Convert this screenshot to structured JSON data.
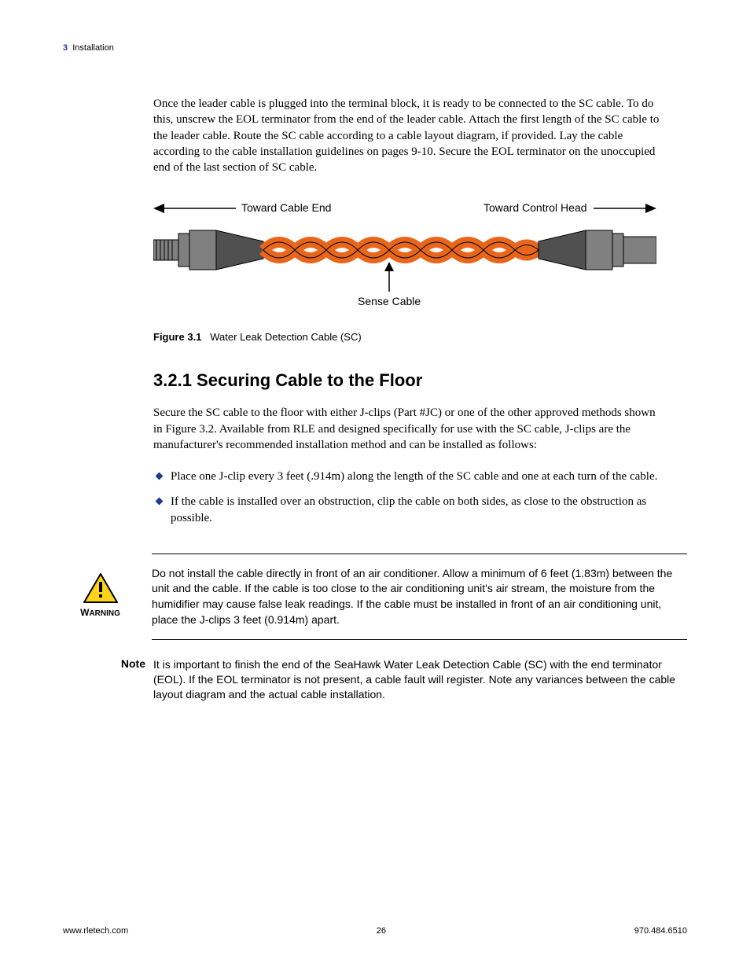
{
  "header": {
    "chapter_num": "3",
    "chapter_title": "Installation"
  },
  "intro_para": "Once the leader cable is plugged into the terminal block, it is ready to be connected to the SC cable. To do this, unscrew the EOL terminator from the end of the leader cable. Attach the first length of the SC cable to the leader cable. Route the SC cable according to a cable layout diagram, if provided. Lay the cable according to the cable installation guidelines on pages 9-10. Secure the EOL terminator on the unoccupied end of the last section of SC cable.",
  "diagram": {
    "left_label": "Toward Cable End",
    "right_label": "Toward Control Head",
    "bottom_label": "Sense Cable"
  },
  "figure_caption": {
    "bold": "Figure 3.1",
    "text": "Water Leak Detection Cable (SC)"
  },
  "subsection_heading": "3.2.1  Securing Cable to the Floor",
  "secure_para": "Secure the SC cable to the floor with either J-clips (Part #JC) or one of the other approved methods shown in Figure 3.2. Available from RLE and designed specifically for use with the SC cable, J-clips are the manufacturer's recommended installation method and can be installed as follows:",
  "bullets": [
    "Place one J-clip every 3 feet (.914m) along the length of the SC cable and one at each turn of the cable.",
    "If the cable is installed over an obstruction, clip the cable on both sides, as close to the obstruction as possible."
  ],
  "warning": {
    "label": "WARNING",
    "text": "Do not install the cable directly in front of an air conditioner. Allow a minimum of 6 feet (1.83m) between the unit and the cable. If the cable is too close to the air conditioning unit's air stream, the moisture from the humidifier may cause false leak readings. If the cable must be installed in front of an air conditioning unit, place the J-clips 3 feet (0.914m) apart."
  },
  "note": {
    "label": "Note",
    "text": "It is important to finish the end of the SeaHawk Water Leak Detection Cable (SC) with the end terminator (EOL). If the EOL terminator is not present, a cable fault will register. Note any variances between the cable layout diagram and the actual cable installation."
  },
  "footer": {
    "left": "www.rletech.com",
    "center": "26",
    "right": "970.484.6510"
  }
}
